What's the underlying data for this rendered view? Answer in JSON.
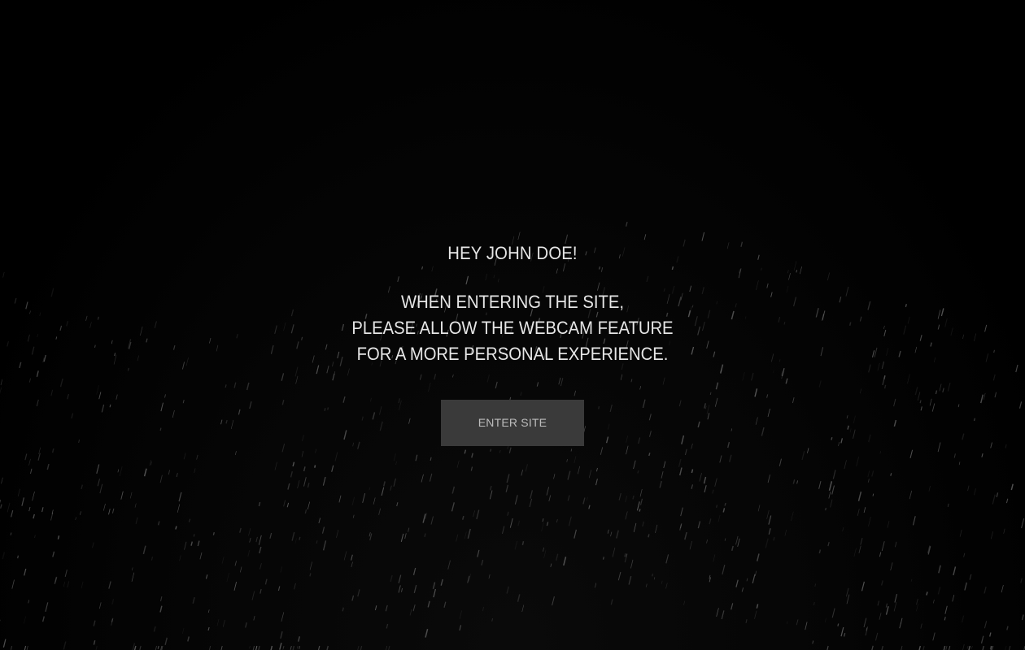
{
  "intro": {
    "greeting": "HEY JOHN DOE!",
    "message_lines": [
      "WHEN ENTERING THE SITE,",
      "PLEASE ALLOW THE WEBCAM FEATURE",
      "FOR A MORE PERSONAL EXPERIENCE."
    ],
    "enter_label": "ENTER SITE"
  },
  "colors": {
    "background": "#000000",
    "text": "#e6e6e6",
    "button_bg": "#3a3a3a",
    "button_text": "#bdbdbd",
    "particle": "#9a9a9a"
  }
}
